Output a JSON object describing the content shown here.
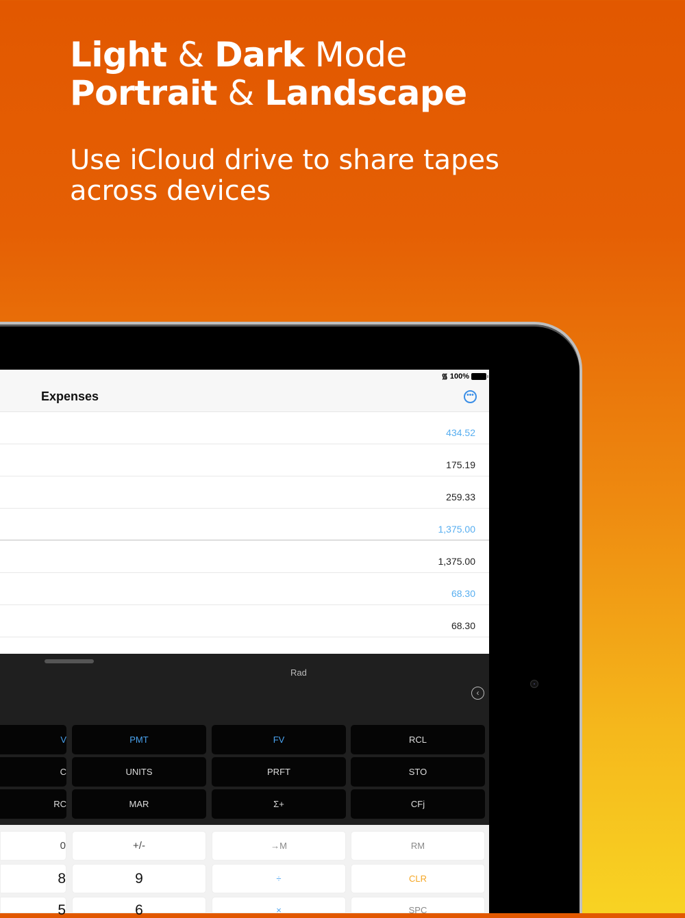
{
  "hero": {
    "line1_a": "Light",
    "line1_b": " & ",
    "line1_c": "Dark",
    "line1_d": " Mode",
    "line2_a": "Portrait",
    "line2_b": " & ",
    "line2_c": "Landscape",
    "subtitle": "Use iCloud drive to share tapes across devices"
  },
  "status": {
    "battery": "100%"
  },
  "nav": {
    "title": "Expenses"
  },
  "tape": [
    {
      "value": "434.52",
      "color": "blue"
    },
    {
      "value": "175.19",
      "color": "dark"
    },
    {
      "value": "259.33",
      "color": "dark"
    },
    {
      "value": "1,375.00",
      "color": "blue"
    },
    {
      "value": "1,375.00",
      "color": "dark"
    },
    {
      "value": "68.30",
      "color": "blue"
    },
    {
      "value": "68.30",
      "color": "dark"
    }
  ],
  "panel": {
    "mode": "Rad"
  },
  "fin_keys": [
    [
      "V",
      "PMT",
      "FV",
      "RCL"
    ],
    [
      "C",
      "UNITS",
      "PRFT",
      "STO"
    ],
    [
      "RC",
      "MAR",
      "Σ+",
      "CFj"
    ]
  ],
  "num_keys": [
    [
      "0",
      "+/-",
      "→M",
      "RM"
    ],
    [
      "8",
      "9",
      "÷",
      "CLR"
    ],
    [
      "5",
      "6",
      "×",
      "SPC"
    ]
  ],
  "colors": {
    "accent": "#3a8ee6",
    "blue_key": "#4aa3f0",
    "clr": "#f5a623"
  }
}
